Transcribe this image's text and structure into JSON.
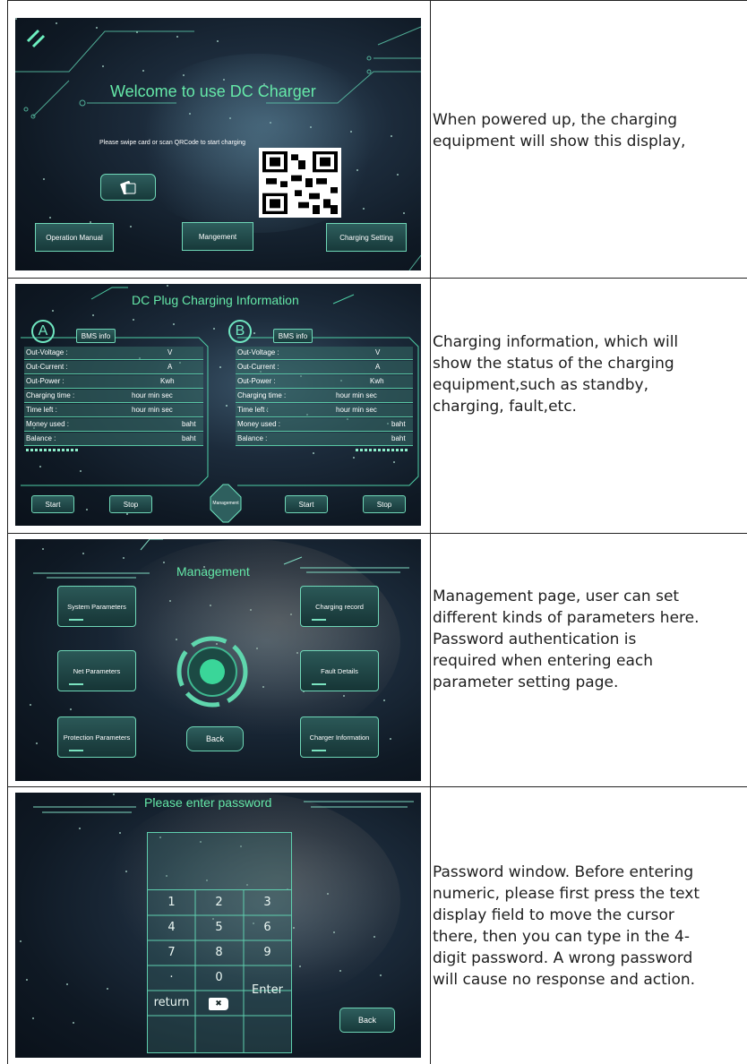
{
  "rows": [
    {
      "description": [
        "When powered up, the charging",
        "equipment will show this display,"
      ],
      "screen": {
        "title": "Welcome to use DC Charger",
        "prompt": "Please swipe card or scan QRCode to start charging",
        "buttons": [
          "Operation  Manual",
          "Mangement",
          "Charging Setting"
        ]
      }
    },
    {
      "description": [
        "Charging information, which will",
        "show the status of the charging",
        "equipment,such as standby,",
        "charging, fault,etc."
      ],
      "screen": {
        "title": "DC Plug Charging Information",
        "panels": [
          {
            "letter": "A",
            "bms": "BMS info"
          },
          {
            "letter": "B",
            "bms": "BMS info"
          }
        ],
        "labels": [
          "Out-Voltage :",
          "Out-Current :",
          "Out-Power :",
          "Charging time :",
          "Time left :",
          "Money used :",
          "Balance :"
        ],
        "units": [
          "V",
          "A",
          "Kwh",
          "hour   min   sec",
          "hour   min   sec",
          "baht",
          "baht"
        ],
        "start": "Start",
        "stop": "Stop",
        "management": "Management"
      }
    },
    {
      "description": [
        "Management page, user can set",
        "different kinds of parameters here.",
        "Password authentication is",
        "required when entering each",
        "parameter setting page."
      ],
      "screen": {
        "title": "Management",
        "left_buttons": [
          "System Parameters",
          "Net Parameters",
          "Protection Parameters"
        ],
        "right_buttons": [
          "Charging record",
          "Fault Details",
          "Charger Information"
        ],
        "back": "Back"
      }
    },
    {
      "description": [
        "Password window. Before entering",
        "numeric, please first press the text",
        "display field to move the cursor",
        "there, then you can type in the 4-",
        "digit password. A wrong password",
        "will cause no response and action."
      ],
      "screen": {
        "title": "Please enter password",
        "keys": [
          "1",
          "2",
          "3",
          "4",
          "5",
          "6",
          "7",
          "8",
          "9",
          "·",
          "0",
          "Enter",
          "return",
          "✖",
          ""
        ],
        "back": "Back"
      }
    }
  ]
}
